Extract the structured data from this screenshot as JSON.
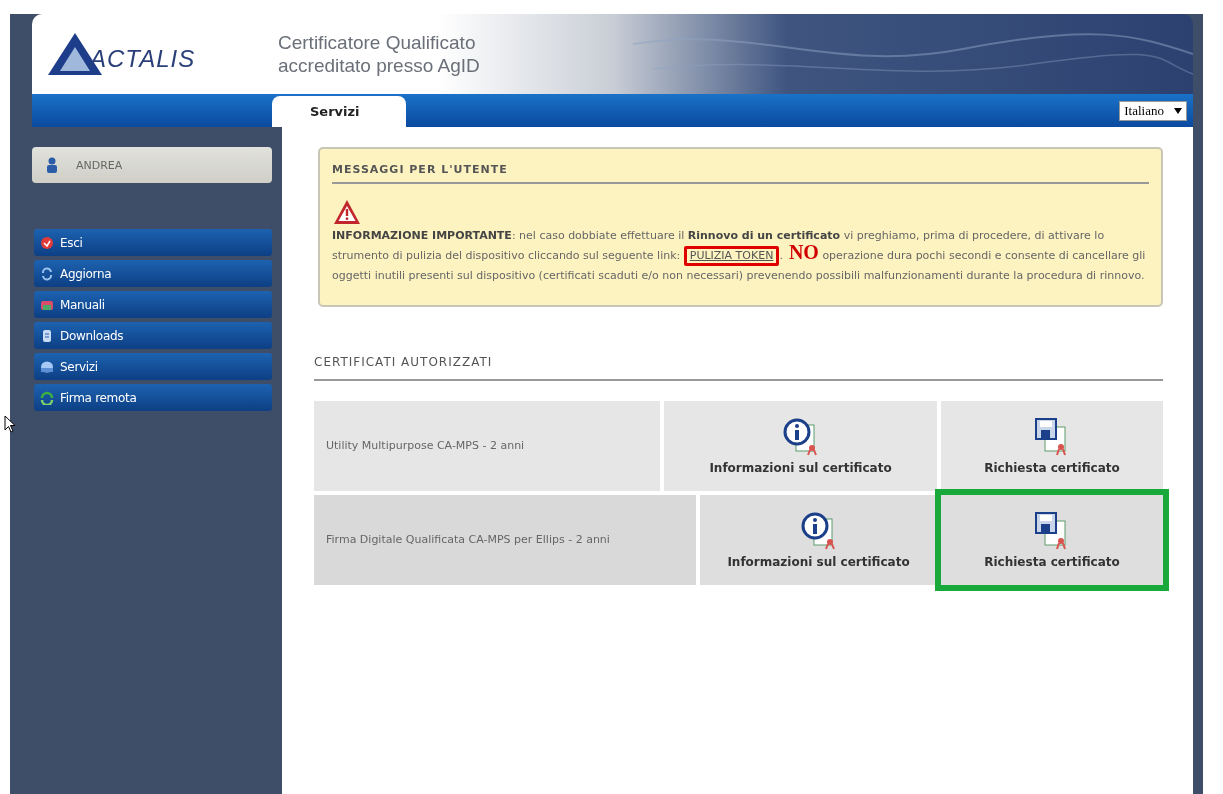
{
  "header": {
    "logo_text": "ACTALIS",
    "tagline": [
      "Certificatore Qualificato",
      "accreditato presso AgID"
    ]
  },
  "tabs": [
    {
      "label": "Servizi",
      "selected": true
    }
  ],
  "language_select": {
    "value": "Italiano"
  },
  "user": {
    "name": "ANDREA"
  },
  "menu": [
    {
      "label": "Esci",
      "kind": "exit"
    },
    {
      "label": "Aggiorna",
      "kind": "refresh"
    },
    {
      "label": "Manuali",
      "kind": "manual"
    },
    {
      "label": "Downloads",
      "kind": "download"
    },
    {
      "label": "Servizi",
      "kind": "services"
    },
    {
      "label": "Firma remota",
      "kind": "sign"
    }
  ],
  "messages": {
    "title": "MESSAGGI PER L'UTENTE",
    "text_before": "**INFORMAZIONE IMPORTANTE**: nel caso dobbiate effettuare il **Rinnovo di un certificato** vi preghiamo, prima di procedere, di attivare lo strumento di pulizia del dispositivo cliccando sul seguente link: ",
    "link": "PULIZIA TOKEN",
    "link_suffix": ".",
    "callout": "NO",
    "text_after": " operazione dura pochi secondi e consente di cancellare gli oggetti inutili presenti sul dispositivo (certificati scaduti e/o non necessari) prevenendo possibili malfunzionamenti durante la procedura di rinnovo."
  },
  "certificates": {
    "title": "CERTIFICATI AUTORIZZATI",
    "rows": [
      {
        "name": "Utility Multipurpose CA-MPS - 2 anni",
        "info": "Informazioni sul certificato",
        "request": "Richiesta certificato",
        "highlighted": false
      },
      {
        "name": "Firma Digitale Qualificata CA-MPS per Ellips - 2 anni",
        "info": "Informazioni sul certificato",
        "request": "Richiesta certificato",
        "highlighted": true
      }
    ]
  }
}
